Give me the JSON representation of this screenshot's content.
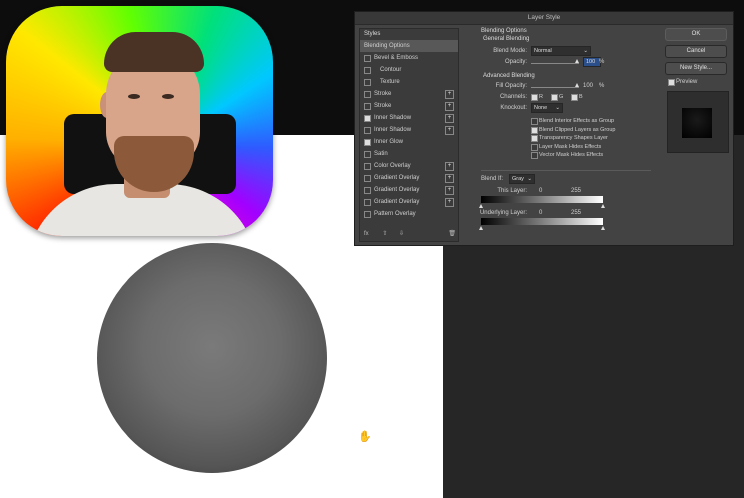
{
  "dialog": {
    "title": "Layer Style",
    "styles_header": "Styles",
    "styles": [
      {
        "label": "Blending Options",
        "checked": false,
        "plus": false,
        "active": true
      },
      {
        "label": "Bevel & Emboss",
        "checked": false,
        "plus": false
      },
      {
        "label": "Contour",
        "checked": false,
        "plus": false,
        "indent": true
      },
      {
        "label": "Texture",
        "checked": false,
        "plus": false,
        "indent": true
      },
      {
        "label": "Stroke",
        "checked": false,
        "plus": true
      },
      {
        "label": "Stroke",
        "checked": false,
        "plus": true
      },
      {
        "label": "Inner Shadow",
        "checked": true,
        "plus": true
      },
      {
        "label": "Inner Shadow",
        "checked": false,
        "plus": true
      },
      {
        "label": "Inner Glow",
        "checked": true,
        "plus": false
      },
      {
        "label": "Satin",
        "checked": false,
        "plus": false
      },
      {
        "label": "Color Overlay",
        "checked": false,
        "plus": true
      },
      {
        "label": "Gradient Overlay",
        "checked": false,
        "plus": true
      },
      {
        "label": "Gradient Overlay",
        "checked": false,
        "plus": true
      },
      {
        "label": "Gradient Overlay",
        "checked": false,
        "plus": true
      },
      {
        "label": "Pattern Overlay",
        "checked": false,
        "plus": false
      }
    ],
    "footer_icons": [
      "fx",
      "⇧",
      "⇩",
      "🗑"
    ],
    "options": {
      "blending_options": "Blending Options",
      "general_blending": "General Blending",
      "blend_mode_label": "Blend Mode:",
      "blend_mode": "Normal",
      "opacity_label": "Opacity:",
      "opacity": "100",
      "opacity_unit": "%",
      "advanced_blending": "Advanced Blending",
      "fill_opacity_label": "Fill Opacity:",
      "fill_opacity": "100",
      "fill_unit": "%",
      "channels_label": "Channels:",
      "channels": [
        "R",
        "G",
        "B"
      ],
      "knockout_label": "Knockout:",
      "knockout": "None",
      "checkboxes": [
        {
          "label": "Blend Interior Effects as Group",
          "checked": false
        },
        {
          "label": "Blend Clipped Layers as Group",
          "checked": true
        },
        {
          "label": "Transparency Shapes Layer",
          "checked": true
        },
        {
          "label": "Layer Mask Hides Effects",
          "checked": false
        },
        {
          "label": "Vector Mask Hides Effects",
          "checked": false
        }
      ],
      "blend_if_label": "Blend If:",
      "blend_if": "Gray",
      "this_layer_label": "This Layer:",
      "this_layer_min": "0",
      "this_layer_max": "255",
      "underlying_label": "Underlying Layer:",
      "underlying_min": "0",
      "underlying_max": "255"
    },
    "buttons": {
      "ok": "OK",
      "cancel": "Cancel",
      "new_style": "New Style..."
    },
    "preview_label": "Preview",
    "preview_checked": true
  },
  "colors": {
    "canvas": "#ffffff",
    "workspace": "#262626",
    "dialog": "#434343"
  }
}
